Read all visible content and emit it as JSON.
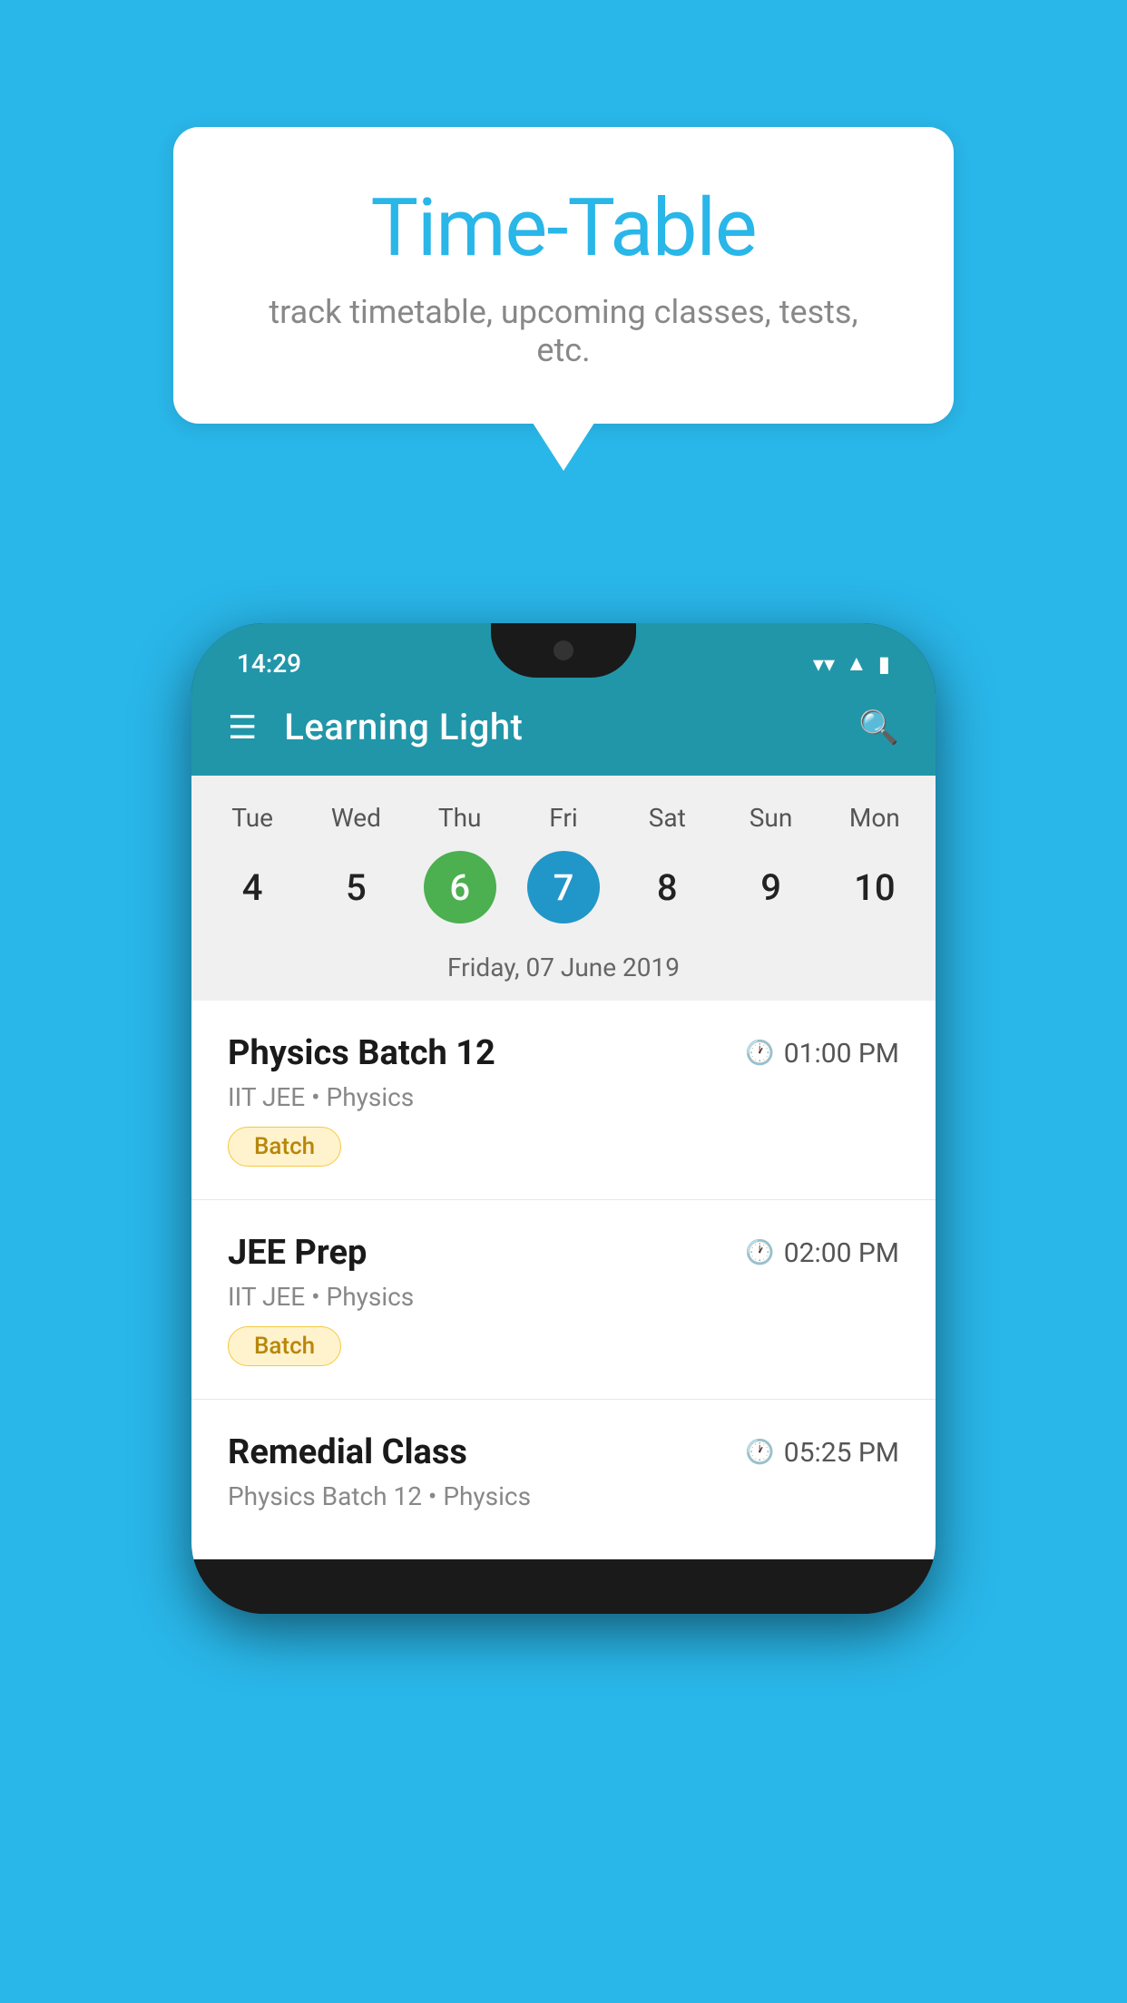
{
  "bubble": {
    "title": "Time-Table",
    "subtitle": "track timetable, upcoming classes, tests, etc."
  },
  "phone": {
    "status_time": "14:29",
    "app_title": "Learning Light",
    "calendar": {
      "headers": [
        "Tue",
        "Wed",
        "Thu",
        "Fri",
        "Sat",
        "Sun",
        "Mon"
      ],
      "numbers": [
        "4",
        "5",
        "6",
        "7",
        "8",
        "9",
        "10"
      ],
      "today_index": 2,
      "selected_index": 3,
      "selected_date_label": "Friday, 07 June 2019"
    },
    "schedule": [
      {
        "title": "Physics Batch 12",
        "time": "01:00 PM",
        "subtitle": "IIT JEE • Physics",
        "tag": "Batch"
      },
      {
        "title": "JEE Prep",
        "time": "02:00 PM",
        "subtitle": "IIT JEE • Physics",
        "tag": "Batch"
      },
      {
        "title": "Remedial Class",
        "time": "05:25 PM",
        "subtitle": "Physics Batch 12 • Physics",
        "tag": ""
      }
    ]
  }
}
